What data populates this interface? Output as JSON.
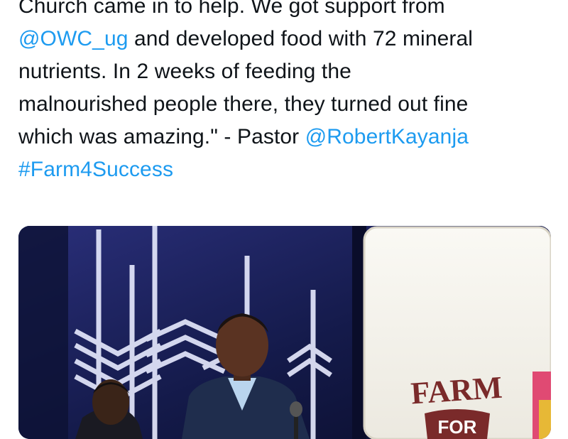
{
  "tweet": {
    "lines": [
      [
        {
          "t": "Church came in to help. We got support from",
          "k": "text"
        }
      ],
      [
        {
          "t": "@OWC_ug",
          "k": "mention"
        },
        {
          "t": " and developed food with 72 mineral",
          "k": "text"
        }
      ],
      [
        {
          "t": "nutrients. In 2 weeks of feeding the",
          "k": "text"
        }
      ],
      [
        {
          "t": "malnourished people there, they turned out fine",
          "k": "text"
        }
      ],
      [
        {
          "t": "which was amazing.\" - Pastor ",
          "k": "text"
        },
        {
          "t": "@RobertKayanja",
          "k": "mention"
        }
      ],
      [
        {
          "t": "#Farm4Success",
          "k": "hashtag"
        }
      ]
    ]
  },
  "media": {
    "banner_text_line1": "FARM",
    "banner_text_line2": "FOR"
  },
  "colors": {
    "link": "#1d9bf0",
    "text": "#0f1419",
    "stage_bg": "#141a4a",
    "banner_text": "#7a2a2a"
  }
}
